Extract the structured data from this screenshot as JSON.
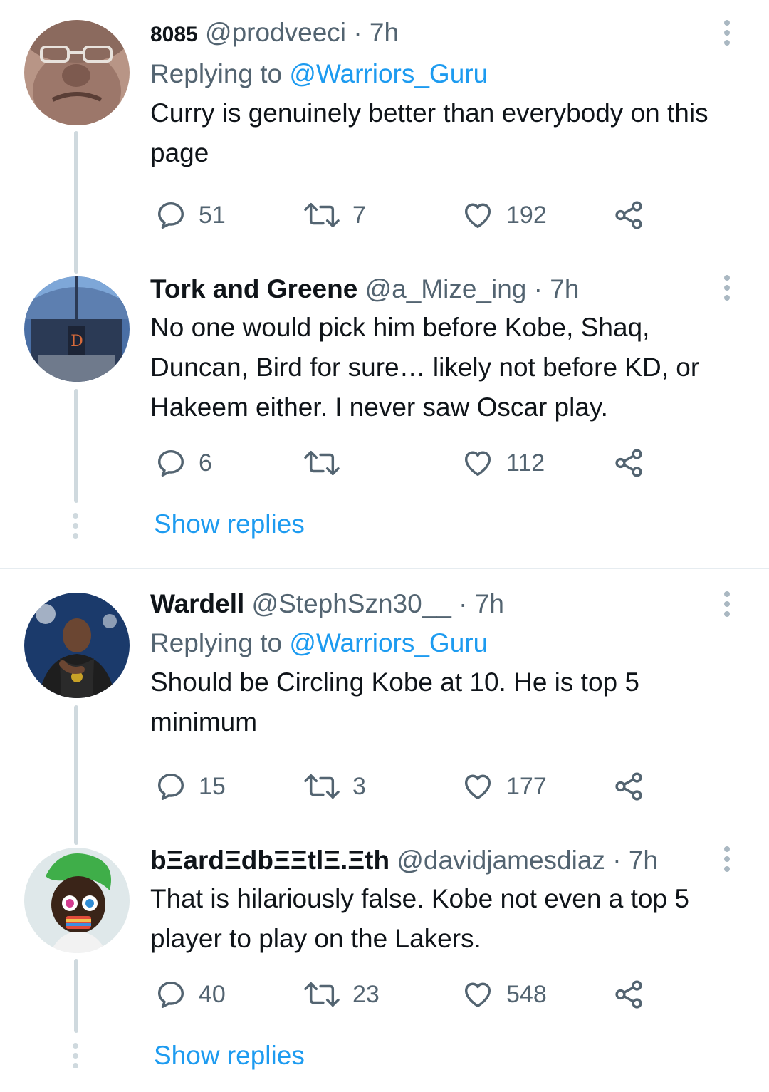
{
  "tweets": [
    {
      "name": "8085",
      "handle": "@prodveeci",
      "dot": "·",
      "time": "7h",
      "replying_prefix": "Replying to ",
      "replying_to": "@Warriors_Guru",
      "text": "Curry is genuinely better than everybody on this page",
      "replies": "51",
      "retweets": "7",
      "likes": "192"
    },
    {
      "name": "Tork and Greene",
      "handle": "@a_Mize_ing",
      "dot": "·",
      "time": "7h",
      "text": "No one would pick him before Kobe, Shaq, Duncan, Bird for sure… likely not before KD, or Hakeem either. I never saw Oscar play.",
      "replies": "6",
      "retweets": "",
      "likes": "112"
    },
    {
      "name": "Wardell",
      "handle": "@StephSzn30__",
      "dot": "·",
      "time": "7h",
      "replying_prefix": "Replying to ",
      "replying_to": "@Warriors_Guru",
      "text": "Should be Circling Kobe at 10. He is top 5 minimum",
      "replies": "15",
      "retweets": "3",
      "likes": "177"
    },
    {
      "name": "bΞardΞdbΞΞtlΞ.Ξth",
      "handle": "@davidjamesdiaz",
      "dot": "·",
      "time": "7h",
      "text": "That is hilariously false. Kobe not even a top 5 player to play on the Lakers.",
      "replies": "40",
      "retweets": "23",
      "likes": "548"
    }
  ],
  "show_replies": [
    "Show replies",
    "Show replies"
  ],
  "colors": {
    "link": "#1d9bf0",
    "secondary_text": "#536471",
    "thread_line": "#cfd9de",
    "divider": "#e6ecf0"
  },
  "icons": [
    "reply-icon",
    "retweet-icon",
    "like-icon",
    "share-icon",
    "more-icon"
  ]
}
